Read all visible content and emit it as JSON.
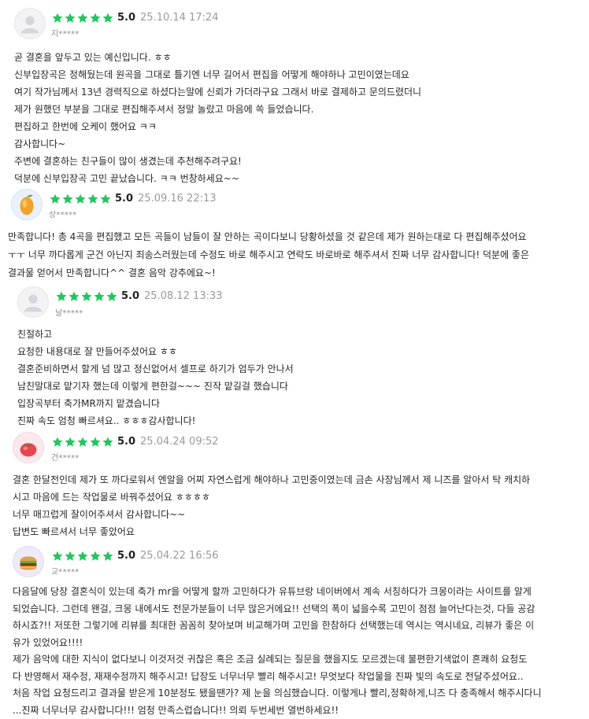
{
  "colors": {
    "star": "#22c55e",
    "text": "#262626",
    "muted": "#9a9a9a"
  },
  "reviews": [
    {
      "avatar": "default-user-icon",
      "score": "5.0",
      "date": "25.10.14 17:24",
      "user": "지*****",
      "lines": [
        "곧 결혼을 앞두고 있는 예신입니다. ㅎㅎ",
        "신부입장곡은 정해뒀는데 원곡을 그대로 틀기엔 너무 길어서 편집을 어떻게 해야하나 고민이였는데요",
        "여기 작가님께서 13년 경력직으로 하셨다는말에 신뢰가 가더라구요 그래서 바로 결제하고 문의드렸더니",
        "제가 원했던 부분을 그대로 편집해주셔서 정말 놀랐고 마음에 쏙 들었습니다.",
        "편집하고 한번에 오케이 했어요 ㅋㅋ",
        "감사합니다~",
        "주변에 결혼하는 친구들이 많이 생겼는데 추천해주려구요!",
        "덕분에 신부입장곡 고민 끝났습니다. ㅋㅋ 번창하세요~~"
      ]
    },
    {
      "avatar": "mango-icon",
      "score": "5.0",
      "date": "25.09.16 22:13",
      "user": "상*****",
      "lines": [
        "만족합니다! 총 4곡을 편집했고 모든 곡들이 남들이 잘 안하는 곡이다보니 당황하셨을 것 같은데 제가 원하는대로 다 편집해주셨어요",
        "ㅜㅜ 너무 까다롭게 군건 아닌지 죄송스러웠는데 수정도 바로 해주시고 연락도 바로바로 해주셔서 진짜 너무 감사합니다! 덕분에 좋은",
        "결과물 얻어서 만족합니다^^ 결혼 음악 강추에요~!"
      ]
    },
    {
      "avatar": "default-user-icon",
      "score": "5.0",
      "date": "25.08.12 13:33",
      "user": "날*****",
      "lines": [
        "친절하고",
        "요청한 내용대로 잘 만들어주셨어요 ㅎㅎ",
        "결혼준비하면서 할게 넘 많고 정신없어서 셀프로 하기가 엄두가 안나서",
        "남친말대로 맡기자 했는데 이렇게 편한걸~~~ 진작 맡길걸 했습니다",
        "입장곡부터 축가MR까지 맡겼습니다",
        "진짜 속도 엄청 빠르셔요.. ㅎㅎㅎ감사합니다!"
      ]
    },
    {
      "avatar": "tomato-icon",
      "score": "5.0",
      "date": "25.04.24 09:52",
      "user": "건*****",
      "lines": [
        "결혼 한달전인데 제가 또 까다로워서 엔알을 어찌 자연스럽게 해야하나 고민중이였는데 금손 사장님께서 제 니즈를 알아서 탁 캐치하",
        "시고 마음에 드는 작업물로 바꿔주셨어요 ㅎㅎㅎㅎ",
        "너무 매끄럽게 잘이어주셔서 감사합니다~~",
        "답변도 빠르셔서 너무 좋았어요"
      ]
    },
    {
      "avatar": "burger-icon",
      "score": "5.0",
      "date": "25.04.22 16:56",
      "user": "교*****",
      "lines": [
        "다음달에 당장 결혼식이 있는데 축가 mr을 어떻게 할까 고민하다가 유튜브랑 네이버에서 계속 서칭하다가 크몽이라는 사이트를 알게",
        "되었습니다. 그런데 왠걸, 크몽 내에서도 전문가분들이 너무 많은거에요!! 선택의 폭이 넓을수록 고민이 점점 늘어난다는것, 다들 공감",
        "하시죠?!! 저또한 그렇기에 리뷰를 최대한 꼼꼼히 찾아보며 비교해가며 고민을 한참하다 선택했는데 역시는 역시네요, 리뷰가 좋은 이",
        "유가 있었어요!!!!",
        " 제가 음악에 대한 지식이 없다보니 이것저것 귀찮은 혹은 조금 실례되는 질문을 했을지도 모르겠는데 불편한기색없이 흔쾌히 요청도",
        "다 반영해서 재수정, 재재수정까지 해주시고!  답장도 너무너무 빨리 해주시고! 무엇보다 작업물을 진짜 빛의 속도로 전달주셨어요..",
        "처음 작업 요청드리고 결과물 받은게 10분정도 됐을땐가? 제 눈을 의심했습니다. 이렇게나 빨리,정확하게,니즈 다 충족해서 해주시다니",
        "...진짜 너무너무 감사합니다!!! 엄청 만족스럽습니다!! 의뢰 두번세번 열번하세요!!"
      ]
    }
  ]
}
